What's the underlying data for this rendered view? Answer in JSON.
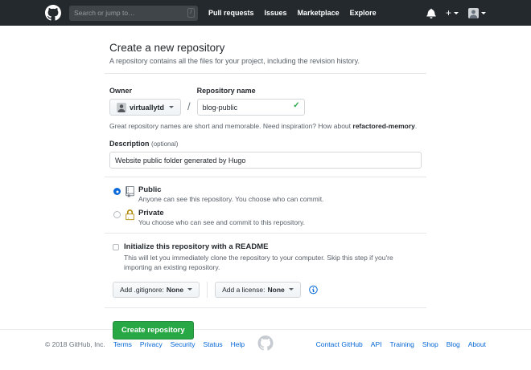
{
  "colors": {
    "header_bg": "#24292e",
    "accent_green": "#28a745",
    "link_blue": "#0366d6",
    "lock_gold": "#b08800",
    "muted_text": "#586069"
  },
  "icons": {
    "logo": "github-mark",
    "notifications": "bell",
    "create_new": "plus",
    "dropdown": "caret-down",
    "valid": "check",
    "visibility_public": "repo-book",
    "visibility_private": "lock",
    "help": "info-circle",
    "plus_glyph": "+",
    "check_glyph": "✓"
  },
  "header": {
    "search_placeholder": "Search or jump to…",
    "search_shortcut": "/",
    "nav": [
      "Pull requests",
      "Issues",
      "Marketplace",
      "Explore"
    ]
  },
  "page": {
    "title": "Create a new repository",
    "subtitle": "A repository contains all the files for your project, including the revision history.",
    "owner_label": "Owner",
    "owner_value": "virtuallytd",
    "path_separator": "/",
    "repo_label": "Repository name",
    "repo_value": "blog-public",
    "hint_prefix": "Great repository names are short and memorable. Need inspiration? How about",
    "hint_suggestion": "refactored-memory",
    "hint_suffix": ".",
    "description_label": "Description",
    "description_optional": "(optional)",
    "description_value": "Website public folder generated by Hugo",
    "visibility": {
      "public_label": "Public",
      "public_desc": "Anyone can see this repository. You choose who can commit.",
      "private_label": "Private",
      "private_desc": "You choose who can see and commit to this repository."
    },
    "readme_label": "Initialize this repository with a README",
    "readme_desc": "This will let you immediately clone the repository to your computer. Skip this step if you're importing an existing repository.",
    "gitignore_label": "Add .gitignore:",
    "gitignore_value": "None",
    "license_label": "Add a license:",
    "license_value": "None",
    "submit_label": "Create repository"
  },
  "footer": {
    "copyright": "© 2018 GitHub, Inc.",
    "links_left": [
      "Terms",
      "Privacy",
      "Security",
      "Status",
      "Help"
    ],
    "links_right": [
      "Contact GitHub",
      "API",
      "Training",
      "Shop",
      "Blog",
      "About"
    ]
  }
}
